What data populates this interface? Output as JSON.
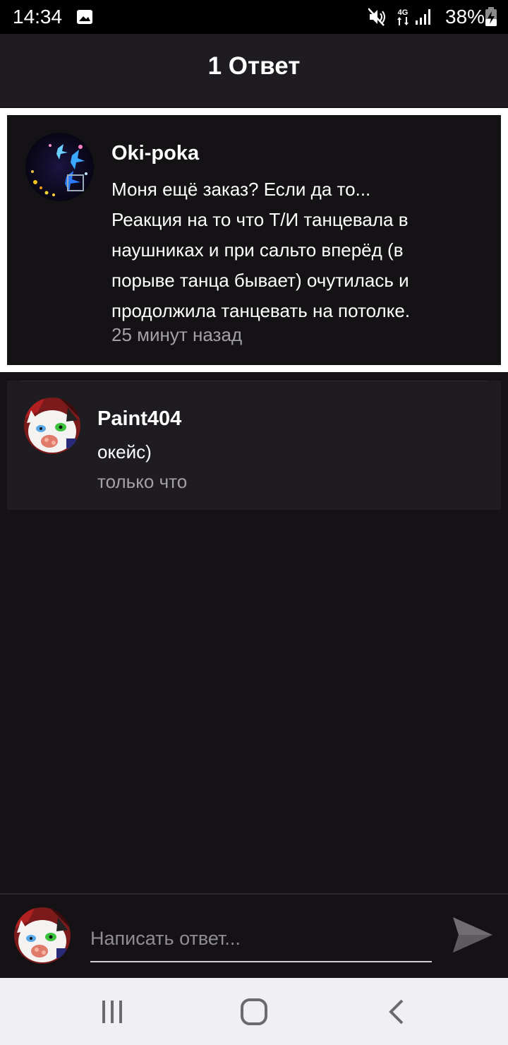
{
  "status_bar": {
    "time": "14:34",
    "battery": "38%",
    "network": "4G",
    "icons": [
      "gallery-icon",
      "mute-icon",
      "network-4g-icon",
      "signal-icon",
      "battery-charging-icon"
    ]
  },
  "header": {
    "title": "1 Ответ"
  },
  "parent_comment": {
    "author": "Oki-poka",
    "text": "Моня ещё заказ? Если да то...\nРеакция на то что Т/И танцевала в\nнаушниках и при сальто вперёд (в\nпорыве танца бывает) очутилась и\nпродолжила танцевать на потолке.",
    "time": "25 минут назад"
  },
  "reply": {
    "author": "Paint404",
    "text": "окейс)",
    "time": "только что"
  },
  "composer": {
    "placeholder": "Написать ответ...",
    "value": ""
  },
  "nav_bar": {
    "buttons": [
      "recent-apps-icon",
      "home-icon",
      "back-icon"
    ]
  },
  "colors": {
    "background": "#141215",
    "card": "#1e1c20",
    "muted_text": "#a3a1a5",
    "highlight_border": "#ffffff"
  }
}
